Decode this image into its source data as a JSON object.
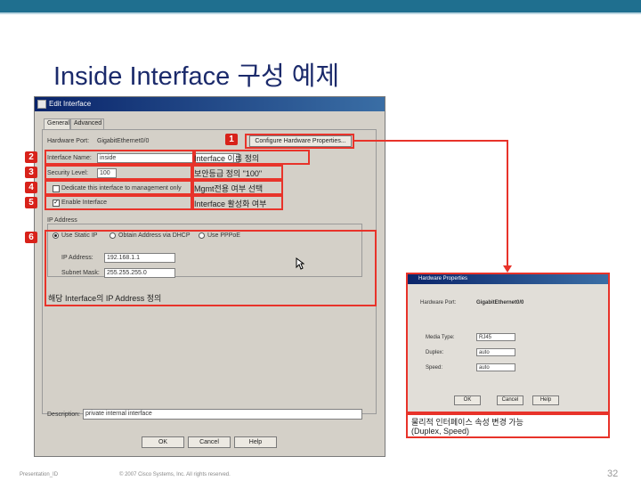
{
  "slide": {
    "title": "Inside Interface 구성 예제",
    "footer_left": "Presentation_ID",
    "footer_mid": "© 2007 Cisco Systems, Inc. All rights reserved.",
    "page": "32"
  },
  "dialog": {
    "title": "Edit Interface",
    "tabs": [
      "General",
      "Advanced"
    ],
    "hardware_port_label": "Hardware Port:",
    "hardware_port_value": "GigabitEthernet0/0",
    "configure_hw_button": "Configure Hardware Properties...",
    "interface_name_label": "Interface Name:",
    "interface_name_value": "inside",
    "security_level_label": "Security Level:",
    "security_level_value": "100",
    "dedicate_mgmt_label": "Dedicate this interface to management only",
    "enable_interface_label": "Enable Interface",
    "ip_address_group": "IP Address",
    "ip_options": [
      "Use Static IP",
      "Obtain Address via DHCP",
      "Use PPPoE"
    ],
    "ip_label": "IP Address:",
    "ip_value": "192.168.1.1",
    "subnet_label": "Subnet Mask:",
    "subnet_value": "255.255.255.0",
    "description_label": "Description:",
    "description_value": "private internal interface",
    "ok_button": "OK",
    "cancel_button": "Cancel",
    "help_button": "Help"
  },
  "annotations": {
    "badges": [
      "1",
      "2",
      "3",
      "4",
      "5",
      "6"
    ],
    "note_name": "Interface 이름 정의",
    "note_security": "보안등급 정의 \"100\"",
    "note_mgmt": "Mgmt전용 여부 선택",
    "note_enable": "Interface 활성화 여부",
    "note_ip": "해당 Interface의 IP Address 정의",
    "note_hw_line1": "물리적 인터페이스 속성 변경 가능",
    "note_hw_line2": "(Duplex, Speed)"
  },
  "hw_dialog": {
    "title": "Hardware Properties",
    "port_label": "Hardware Port:",
    "port_value": "GigabitEthernet0/0",
    "media_label": "Media Type:",
    "media_value": "RJ45",
    "duplex_label": "Duplex:",
    "duplex_value": "auto",
    "speed_label": "Speed:",
    "speed_value": "auto",
    "ok_button": "OK",
    "cancel_button": "Cancel",
    "help_button": "Help"
  },
  "colors": {
    "annotation_red": "#e8332a",
    "title_blue": "#1b2a6b",
    "topbar": "#1f6f8f"
  }
}
